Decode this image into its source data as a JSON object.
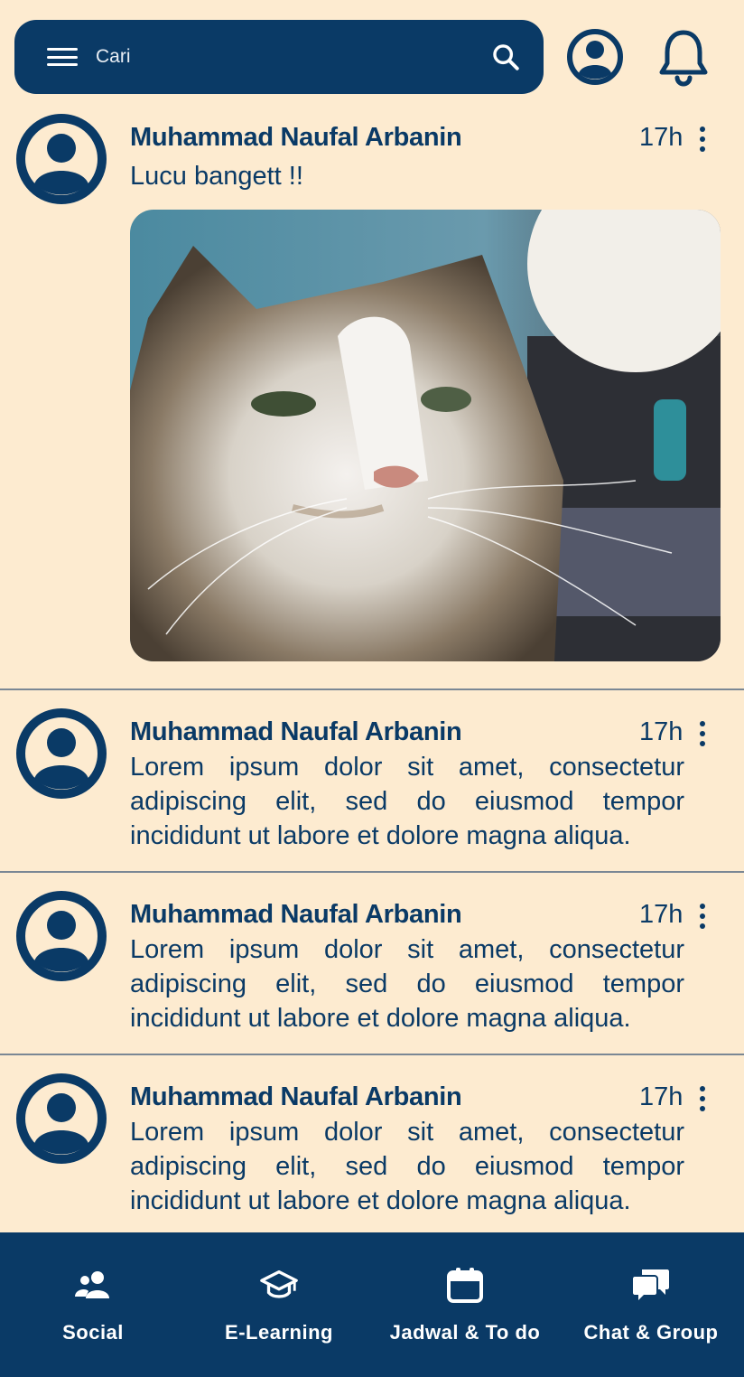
{
  "search": {
    "placeholder": "Cari"
  },
  "icons": {
    "menu": "hamburger-menu-icon",
    "search": "search-icon",
    "profile": "user-circle-icon",
    "notifications": "bell-icon",
    "more": "more-vertical-icon"
  },
  "colors": {
    "primary": "#0a3a66",
    "background": "#fdebd0",
    "divider": "#7a8794"
  },
  "posts": [
    {
      "author": "Muhammad Naufal Arbanin",
      "time": "17h",
      "text": "Lucu bangett !!",
      "has_image": true
    },
    {
      "author": "Muhammad Naufal Arbanin",
      "time": "17h",
      "text": "Lorem ipsum dolor sit amet, consectetur adipiscing elit, sed do eiusmod tempor incididunt ut labore et dolore magna aliqua."
    },
    {
      "author": "Muhammad Naufal Arbanin",
      "time": "17h",
      "text": "Lorem ipsum dolor sit amet, consectetur adipiscing elit, sed do eiusmod tempor incididunt ut labore et dolore magna aliqua."
    },
    {
      "author": "Muhammad Naufal Arbanin",
      "time": "17h",
      "text": "Lorem ipsum dolor sit amet, consectetur adipiscing elit, sed do eiusmod tempor incididunt ut labore et dolore magna aliqua."
    }
  ],
  "nav": [
    {
      "label": "Social",
      "icon": "users-icon"
    },
    {
      "label": "E-Learning",
      "icon": "graduation-cap-icon"
    },
    {
      "label": "Jadwal & To do",
      "icon": "calendar-icon"
    },
    {
      "label": "Chat & Group",
      "icon": "chat-bubbles-icon"
    }
  ]
}
